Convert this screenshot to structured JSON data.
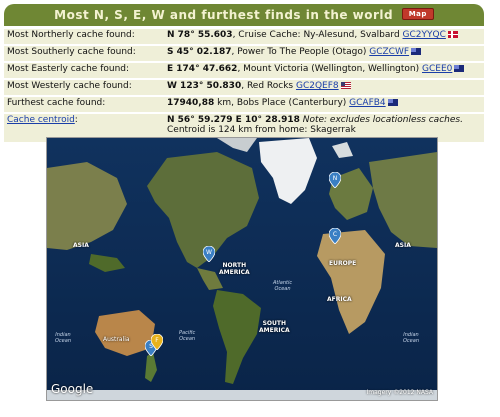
{
  "title": "Most N, S, E, W and furthest finds in the world",
  "map_button_label": "Map",
  "rows": [
    {
      "label": "Most Northerly cache found:",
      "coord": "N 78° 55.603",
      "text": ", Cruise Cache: Ny-Alesund, Svalbard ",
      "code": "GC2YYQC",
      "flag": "flag-no"
    },
    {
      "label": "Most Southerly cache found:",
      "coord": "S 45° 02.187",
      "text": ", Power To The People (Otago) ",
      "code": "GCZCWF",
      "flag": "flag-nz"
    },
    {
      "label": "Most Easterly cache found:",
      "coord": "E 174° 47.662",
      "text": ", Mount Victoria (Wellington, Wellington) ",
      "code": "GCEE0",
      "flag": "flag-nz"
    },
    {
      "label": "Most Westerly cache found:",
      "coord": "W 123° 50.830",
      "text": ", Red Rocks ",
      "code": "GC2QEF8",
      "flag": "flag-us"
    },
    {
      "label": "Furthest cache found:",
      "coord": "17940,88",
      "text": " km, Bobs Place (Canterbury) ",
      "code": "GCAFB4",
      "flag": "flag-nz"
    }
  ],
  "centroid": {
    "label": "Cache centroid",
    "colon": ":",
    "coord": "N 56° 59.279 E 10° 28.918",
    "note": "Note: excludes locationless caches.",
    "line2": "Centroid is 124 km from home: Skagerrak"
  },
  "map": {
    "labels": {
      "asia_left": "ASIA",
      "north_america": "NORTH\nAMERICA",
      "europe": "EUROPE",
      "asia_right": "ASIA",
      "africa": "AFRICA",
      "south_america": "SOUTH\nAMERICA",
      "australia": "Australia",
      "atlantic": "Atlantic\nOcean",
      "pacific": "Pacific\nOcean",
      "indian_left": "Indian\nOcean",
      "indian_right": "Indian\nOcean"
    },
    "pins": [
      "N",
      "W",
      "C",
      "S",
      "F"
    ],
    "google": "Google",
    "imagery": "Imagery ©2012 NASA"
  },
  "colors": {
    "header_bg": "#6f8734",
    "row_bg": "#efefd8",
    "link": "#1a3ea8"
  }
}
